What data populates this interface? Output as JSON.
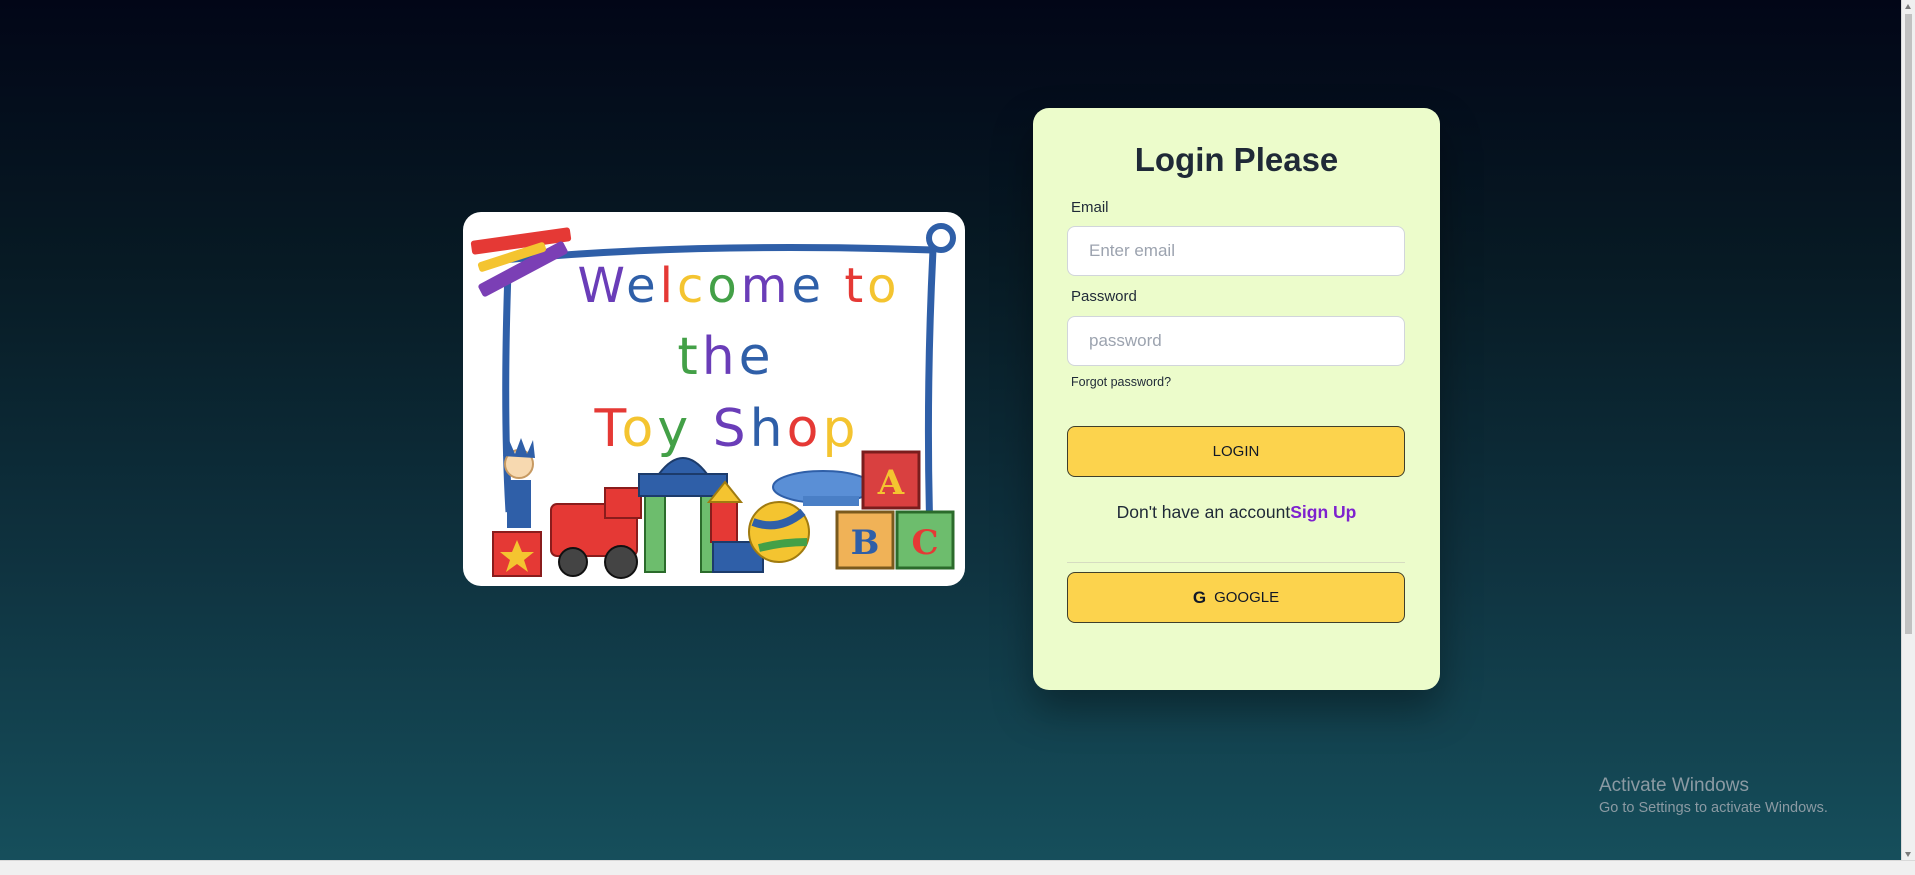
{
  "welcome_image": {
    "line1": "Welcome to",
    "line2": "the",
    "line3": "Toy Shop",
    "blocks": [
      "A",
      "B",
      "C"
    ]
  },
  "login": {
    "title": "Login Please",
    "email_label": "Email",
    "email_placeholder": "Enter email",
    "password_label": "Password",
    "password_placeholder": "password",
    "forgot_label": "Forgot password?",
    "login_button": "LOGIN",
    "signup_prompt": "Don't have an account",
    "signup_link": "Sign Up",
    "google_button": "GOOGLE",
    "google_icon": "google-icon"
  },
  "watermark": {
    "title": "Activate Windows",
    "subtitle": "Go to Settings to activate Windows."
  },
  "colors": {
    "card_bg": "#ecfccb",
    "button_bg": "#fcd34d",
    "link": "#7e22ce"
  }
}
